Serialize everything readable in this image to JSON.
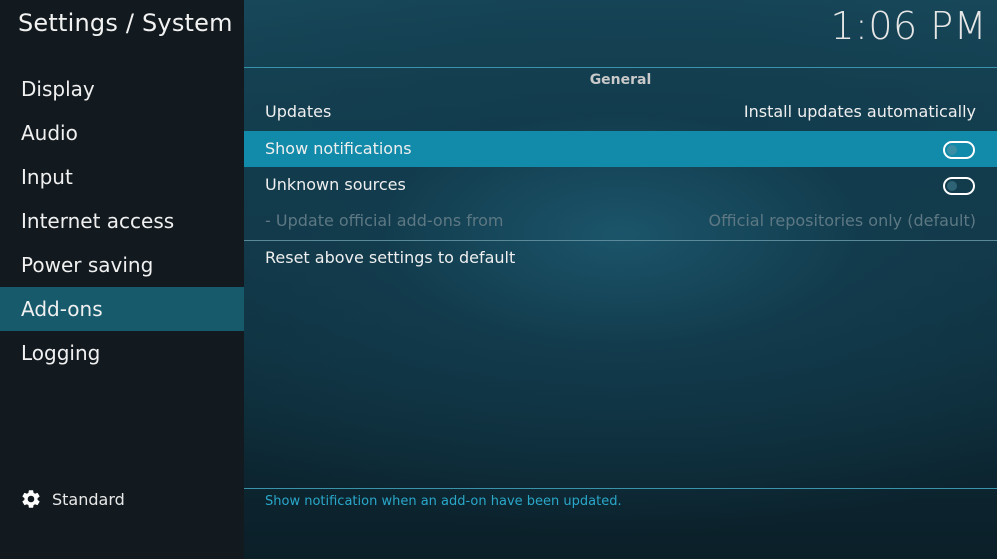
{
  "header": {
    "title": "Settings / System",
    "clock": "1:06 PM"
  },
  "sidebar": {
    "items": [
      {
        "label": "Display"
      },
      {
        "label": "Audio"
      },
      {
        "label": "Input"
      },
      {
        "label": "Internet access"
      },
      {
        "label": "Power saving"
      },
      {
        "label": "Add-ons"
      },
      {
        "label": "Logging"
      }
    ],
    "active_index": 5,
    "profile": {
      "label": "Standard",
      "icon": "gear-icon"
    }
  },
  "main": {
    "group_title": "General",
    "settings": [
      {
        "label": "Updates",
        "value": "Install updates automatically"
      },
      {
        "label": "Show notifications",
        "toggle": "off"
      },
      {
        "label": "Unknown sources",
        "toggle": "off"
      },
      {
        "label": "- Update official add-ons from",
        "value": "Official repositories only (default)"
      }
    ],
    "reset_label": "Reset above settings to default",
    "hint": "Show notification when an add-on have been updated."
  },
  "colors": {
    "accent": "#128aa9",
    "sidebar_active": "#165a6c",
    "hint_text": "#2aa7c9"
  }
}
